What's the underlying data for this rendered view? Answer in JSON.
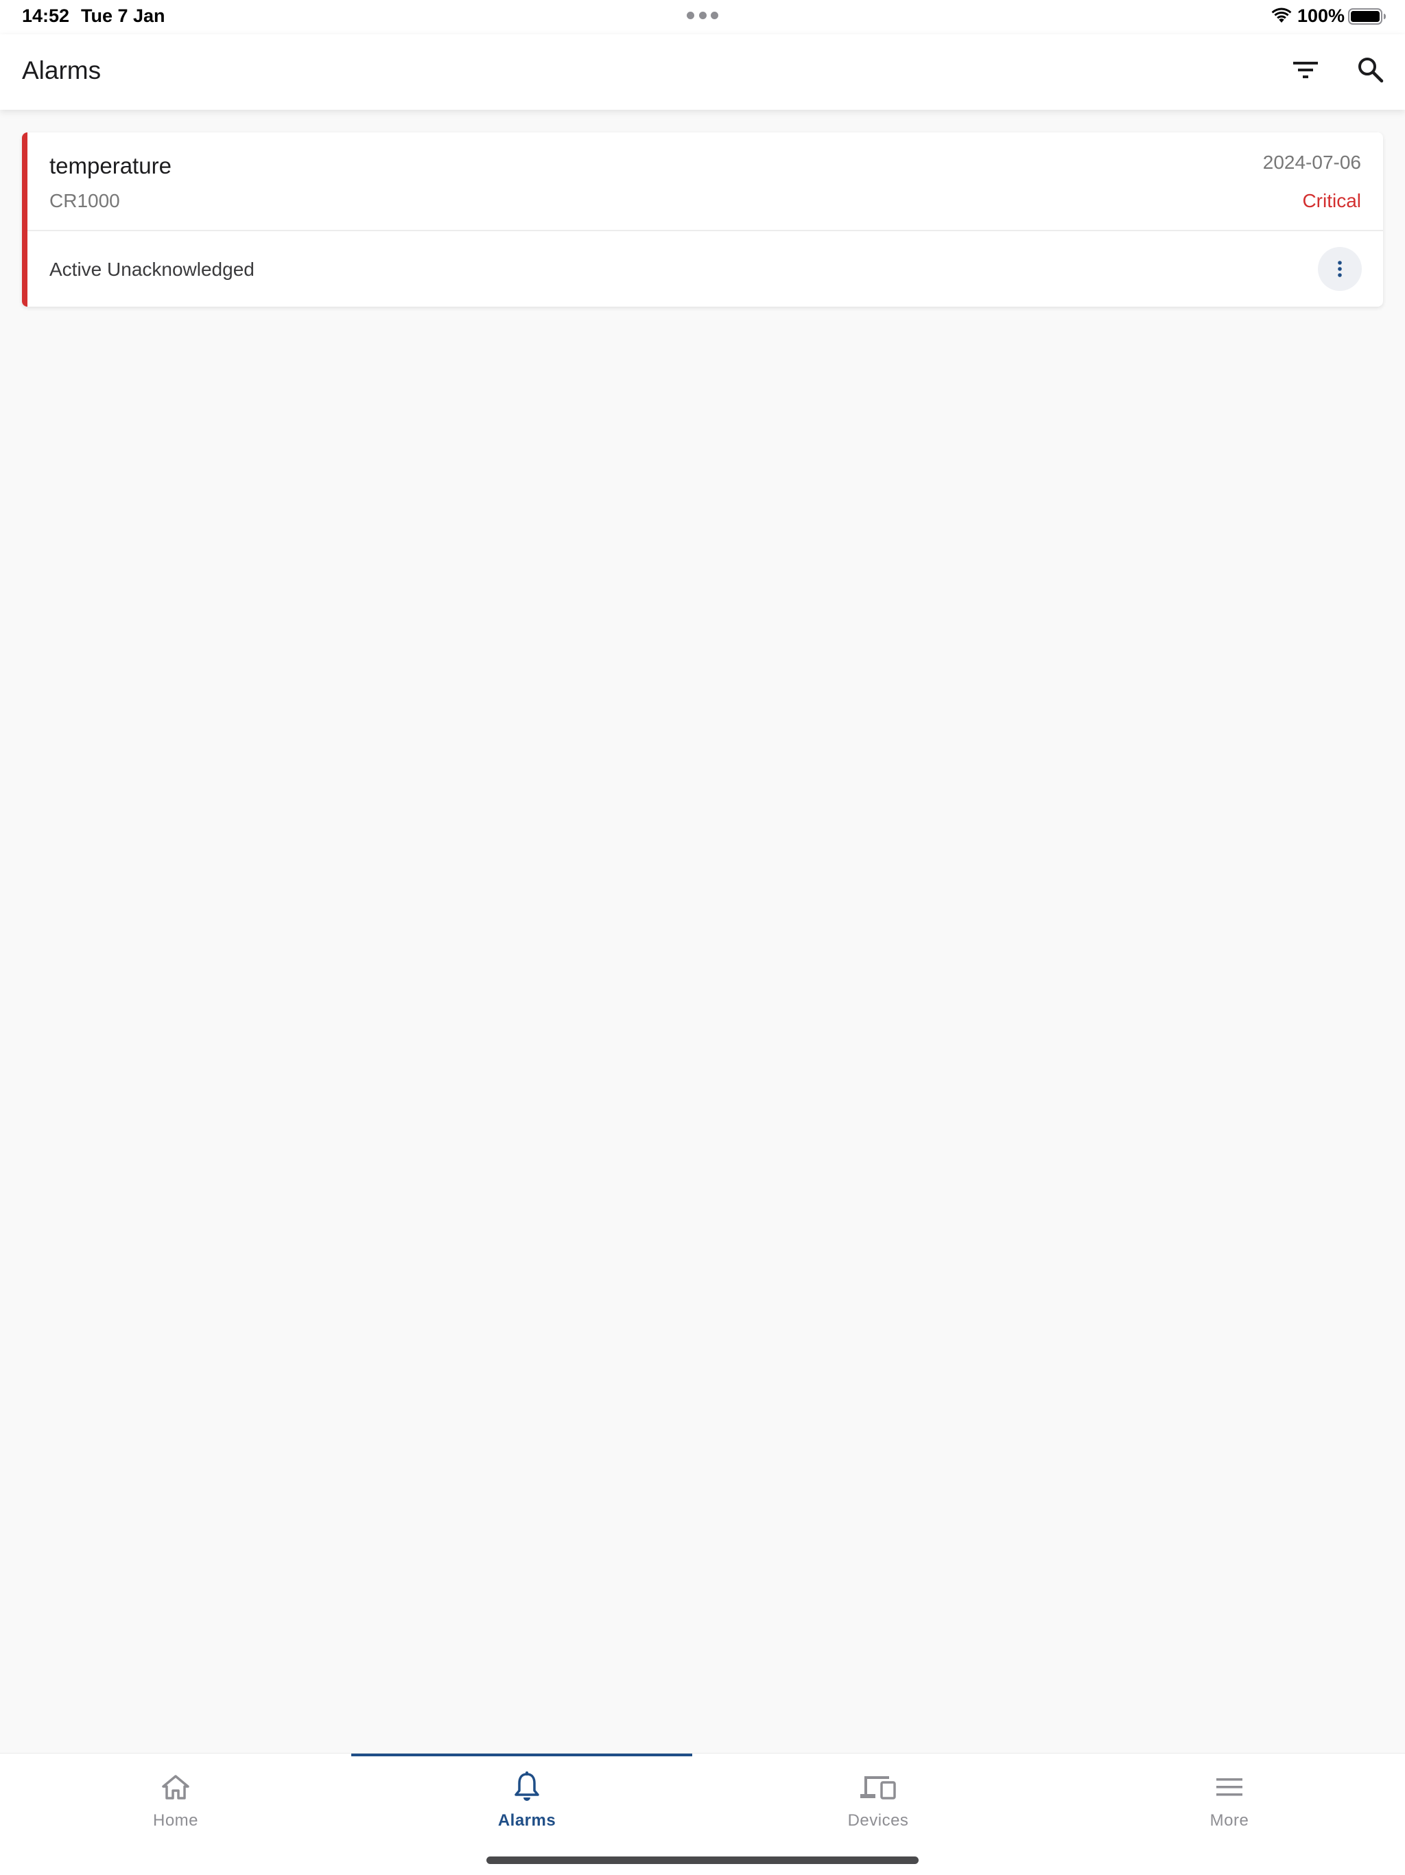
{
  "status_bar": {
    "time": "14:52",
    "date": "Tue 7 Jan",
    "battery": "100%",
    "icons": [
      "multitasking-dots-icon",
      "wifi-icon",
      "battery-icon"
    ]
  },
  "app_bar": {
    "title": "Alarms",
    "actions": [
      "filter-icon",
      "search-icon"
    ]
  },
  "alarms": [
    {
      "name": "temperature",
      "device": "CR1000",
      "date": "2024-07-06",
      "severity": "Critical",
      "status": "Active Unacknowledged"
    }
  ],
  "bottom_nav": {
    "items": [
      {
        "label": "Home",
        "icon": "home-icon",
        "active": false
      },
      {
        "label": "Alarms",
        "icon": "bell-icon",
        "active": true
      },
      {
        "label": "Devices",
        "icon": "devices-icon",
        "active": false
      },
      {
        "label": "More",
        "icon": "menu-icon",
        "active": false
      }
    ]
  },
  "colors": {
    "critical": "#d32f2f",
    "primary": "#1f4e87",
    "inactive": "#8e8e93",
    "background": "#f9f9f9"
  }
}
